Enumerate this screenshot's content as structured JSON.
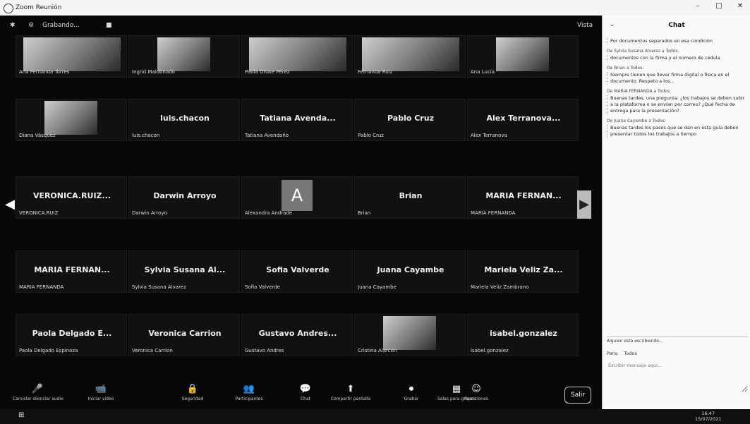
{
  "window": {
    "title": "Zoom Reunión",
    "min": "–",
    "max": "□",
    "close": "✕"
  },
  "topbar": {
    "left_icon_1": "✱",
    "left_icon_2": "⚙",
    "left_text": "Grabando...",
    "left_icon_3": "■",
    "view_label": "Vista"
  },
  "tiles": [
    {
      "id": "t1",
      "kind": "video",
      "caption": "Ana Fernanda Torres"
    },
    {
      "id": "t2",
      "kind": "video-small",
      "caption": "Ingrid Maldonado"
    },
    {
      "id": "t3",
      "kind": "video",
      "caption": "Paola Oñate Pérez"
    },
    {
      "id": "t4",
      "kind": "video",
      "caption": "Fernanda Ruiz"
    },
    {
      "id": "t5",
      "kind": "video-small",
      "caption": "Ana Lucía"
    },
    {
      "id": "t6",
      "kind": "video-small",
      "caption": "Diana Vásquez"
    },
    {
      "id": "t7",
      "kind": "name",
      "name": "luis.chacon",
      "caption": "luis.chacon"
    },
    {
      "id": "t8",
      "kind": "name",
      "name": "Tatiana Avenda...",
      "caption": "Tatiana Avendaño"
    },
    {
      "id": "t9",
      "kind": "name",
      "name": "Pablo Cruz",
      "caption": "Pablo Cruz"
    },
    {
      "id": "t10",
      "kind": "name",
      "name": "Alex Terranova...",
      "caption": "Alex Terranova"
    },
    {
      "id": "t11",
      "kind": "name",
      "name": "VERONICA.RUIZ...",
      "caption": "VERONICA.RUIZ"
    },
    {
      "id": "t12",
      "kind": "name",
      "name": "Darwin Arroyo",
      "caption": "Darwin Arroyo"
    },
    {
      "id": "t13",
      "kind": "avatar",
      "letter": "A",
      "caption": "Alexandra Andrade"
    },
    {
      "id": "t14",
      "kind": "name",
      "name": "Brian",
      "caption": "Brian"
    },
    {
      "id": "t15",
      "kind": "name",
      "name": "MARIA FERNAN...",
      "caption": "MARIA FERNANDA"
    },
    {
      "id": "t16",
      "kind": "name",
      "name": "MARIA FERNAN...",
      "caption": "MARIA FERNANDA"
    },
    {
      "id": "t17",
      "kind": "name",
      "name": "Sylvia Susana Al...",
      "caption": "Sylvia Susana Alvarez"
    },
    {
      "id": "t18",
      "kind": "name",
      "name": "Sofia Valverde",
      "caption": "Sofia Valverde"
    },
    {
      "id": "t19",
      "kind": "name",
      "name": "Juana Cayambe",
      "caption": "Juana Cayambe"
    },
    {
      "id": "t20",
      "kind": "name",
      "name": "Mariela Veliz Za...",
      "caption": "Mariela Veliz Zambrano"
    },
    {
      "id": "t21",
      "kind": "name",
      "name": "Paola Delgado E...",
      "caption": "Paola Delgado Espinoza"
    },
    {
      "id": "t22",
      "kind": "name",
      "name": "Veronica Carrion",
      "caption": "Veronica Carrion"
    },
    {
      "id": "t23",
      "kind": "name",
      "name": "Gustavo Andres...",
      "caption": "Gustavo Andres"
    },
    {
      "id": "t24",
      "kind": "video-small",
      "caption": "Cristina Alarcón"
    },
    {
      "id": "t25",
      "kind": "name",
      "name": "isabel.gonzalez",
      "caption": "isabel.gonzalez"
    }
  ],
  "nav": {
    "left": "◀",
    "right": "▶"
  },
  "toolbar": {
    "items": [
      {
        "icon": "🎤",
        "label": "Cancelar silenciar audio"
      },
      {
        "icon": "📹",
        "label": "Iniciar video"
      },
      {
        "icon": "🔒",
        "label": "Seguridad"
      },
      {
        "icon": "👥",
        "label": "Participantes"
      },
      {
        "icon": "💬",
        "label": "Chat"
      },
      {
        "icon": "⬆",
        "label": "Compartir pantalla"
      },
      {
        "icon": "⏺",
        "label": "Grabar"
      },
      {
        "icon": "▦",
        "label": "Salas para grupos"
      },
      {
        "icon": "☺",
        "label": "Reacciones"
      }
    ],
    "leave_label": "Salir"
  },
  "chat": {
    "title": "Chat",
    "collapse": "⌄",
    "messages": [
      {
        "from": "",
        "body": "Por documentos separados en esa condición"
      },
      {
        "from": "De Sylvia Susana Alvarez a Todos:",
        "body": "documentos con la firma y el número de cédula"
      },
      {
        "from": "De Brian a Todos:",
        "body": "Siempre tienen que llevar firma digital o física en el documento. Respeto a los..."
      },
      {
        "from": "De MARIA FERNANDA a Todos:",
        "body": "Buenas tardes, una pregunta: ¿los trabajos se deben subir a la plataforma o se envían por correo? ¿Qué fecha de entrega para la presentación?"
      },
      {
        "from": "De Juana Cayambe a Todos:",
        "body": "Buenas tardes los pasos que se dan en esta guía deben presentar todos los trabajos a tiempo"
      }
    ],
    "typing": "Alguien está escribiendo...",
    "to_label": "Para:",
    "to_value": "Todos",
    "input_placeholder": "Escribir mensaje aquí..."
  },
  "taskbar": {
    "start": "⊞",
    "time": "16:47",
    "date": "15/07/2021"
  }
}
